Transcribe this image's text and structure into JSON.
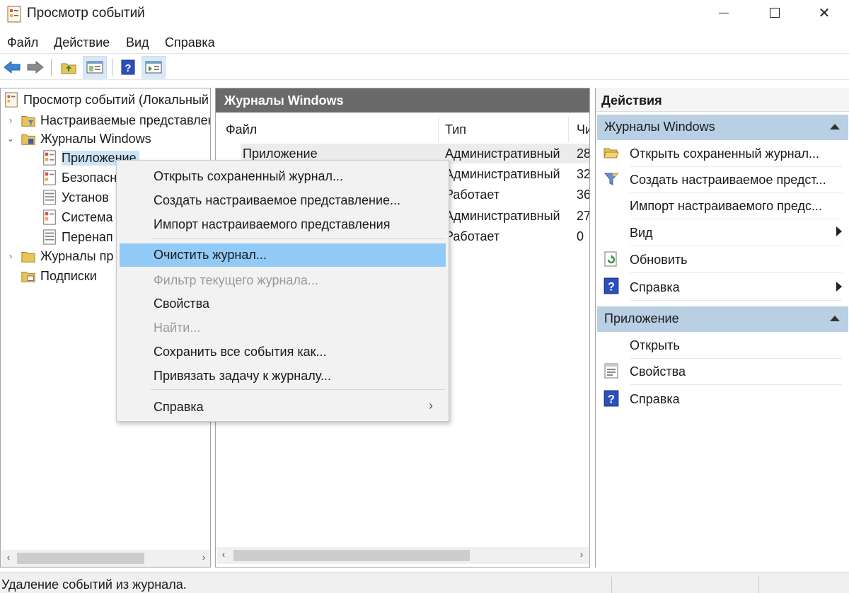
{
  "window": {
    "title": "Просмотр событий"
  },
  "menubar": [
    "Файл",
    "Действие",
    "Вид",
    "Справка"
  ],
  "tree": {
    "root": "Просмотр событий (Локальный",
    "items": [
      {
        "label": "Настраиваемые представлен",
        "level": 1,
        "expander": "›"
      },
      {
        "label": "Журналы Windows",
        "level": 1,
        "expander": "⌄"
      },
      {
        "label": "Приложение",
        "level": 2
      },
      {
        "label": "Безопасн",
        "level": 2
      },
      {
        "label": "Установ",
        "level": 2
      },
      {
        "label": "Система",
        "level": 2
      },
      {
        "label": "Перенап",
        "level": 2
      },
      {
        "label": "Журналы пр",
        "level": 1,
        "expander": "›"
      },
      {
        "label": "Подписки",
        "level": 1
      }
    ]
  },
  "center": {
    "header": "Журналы Windows",
    "columns": [
      "Файл",
      "Тип",
      "Чи"
    ],
    "rows": [
      [
        "Приложение",
        "Административный",
        "28"
      ],
      [
        "",
        "Административный",
        "32"
      ],
      [
        "",
        "Работает",
        "36"
      ],
      [
        "",
        "Административный",
        "27"
      ],
      [
        "",
        "Работает",
        "0"
      ]
    ]
  },
  "actions": {
    "title": "Действия",
    "group1": {
      "label": "Журналы Windows",
      "items": [
        {
          "label": "Открыть сохраненный журнал...",
          "icon": "folder-open-icon"
        },
        {
          "label": "Создать настраиваемое предст...",
          "icon": "filter-icon"
        },
        {
          "label": "Импорт настраиваемого предс...",
          "icon": ""
        },
        {
          "label": "Вид",
          "icon": "",
          "submenu": true
        },
        {
          "label": "Обновить",
          "icon": "refresh-icon"
        },
        {
          "label": "Справка",
          "icon": "help-icon",
          "submenu": true
        }
      ]
    },
    "group2": {
      "label": "Приложение",
      "items": [
        {
          "label": "Открыть",
          "icon": ""
        },
        {
          "label": "Свойства",
          "icon": "properties-icon"
        },
        {
          "label": "Справка",
          "icon": "help-icon"
        }
      ]
    }
  },
  "context_menu": {
    "items": [
      {
        "label": "Открыть сохраненный журнал...",
        "state": "normal"
      },
      {
        "label": "Создать настраиваемое представление...",
        "state": "normal"
      },
      {
        "label": "Импорт настраиваемого представления",
        "state": "normal"
      },
      {
        "label": "Очистить журнал...",
        "state": "highlighted"
      },
      {
        "label": "Фильтр текущего журнала...",
        "state": "disabled"
      },
      {
        "label": "Свойства",
        "state": "normal"
      },
      {
        "label": "Найти...",
        "state": "disabled"
      },
      {
        "label": "Сохранить все события как...",
        "state": "normal"
      },
      {
        "label": "Привязать задачу к журналу...",
        "state": "normal"
      },
      {
        "label": "Справка",
        "state": "normal",
        "submenu": true
      }
    ]
  },
  "status": {
    "text": "Удаление событий из журнала."
  },
  "colors": {
    "accent_highlight": "#91c9f7",
    "group_header": "#b8cfe4",
    "center_header": "#6a6a6a"
  }
}
